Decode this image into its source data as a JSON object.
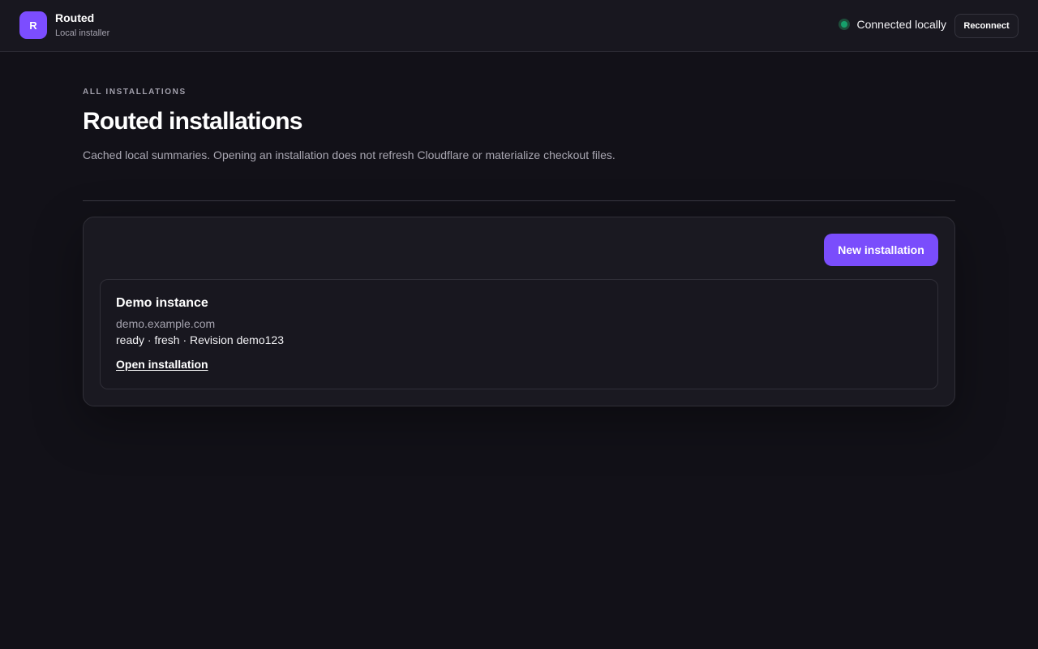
{
  "header": {
    "logo_letter": "R",
    "app_name": "Routed",
    "app_subtitle": "Local installer",
    "status_text": "Connected locally",
    "reconnect_label": "Reconnect"
  },
  "page": {
    "eyebrow": "ALL INSTALLATIONS",
    "title": "Routed installations",
    "description": "Cached local summaries. Opening an installation does not refresh Cloudflare or materialize checkout files."
  },
  "panel": {
    "new_button_label": "New installation",
    "installations": [
      {
        "name": "Demo instance",
        "domain": "demo.example.com",
        "meta": "ready · fresh · Revision demo123",
        "open_label": "Open installation"
      }
    ]
  },
  "colors": {
    "accent": "#7a4dfc",
    "status_online": "#16a06b",
    "background": "#121118"
  }
}
